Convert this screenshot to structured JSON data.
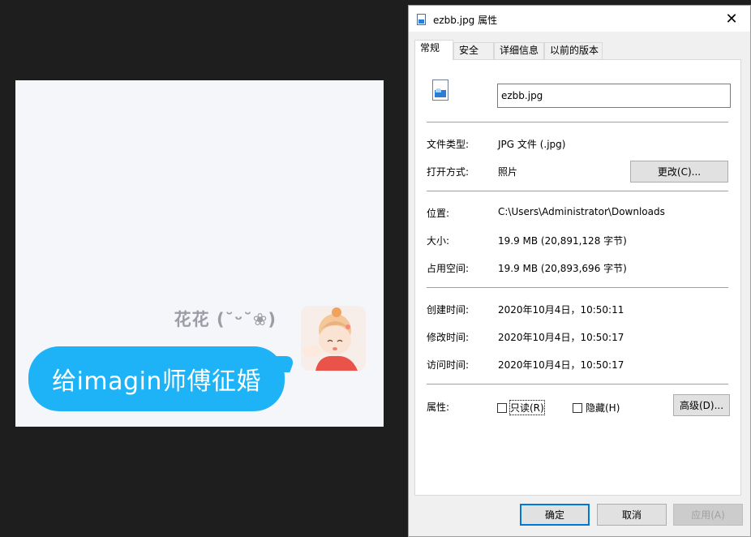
{
  "chat": {
    "sender_name": "花花 (˘ᵕ˘❀)",
    "message": "给imagin师傅征婚"
  },
  "dialog": {
    "title": "ezbb.jpg 属性",
    "close_glyph": "✕",
    "tabs": [
      "常规",
      "安全",
      "详细信息",
      "以前的版本"
    ],
    "active_tab": "常规",
    "file_name": "ezbb.jpg",
    "file_type_label": "文件类型:",
    "file_type_value": "JPG 文件 (.jpg)",
    "opens_with_label": "打开方式:",
    "opens_with_value": "照片",
    "change_button": "更改(C)...",
    "location_label": "位置:",
    "location_value": "C:\\Users\\Administrator\\Downloads",
    "size_label": "大小:",
    "size_value": "19.9 MB (20,891,128 字节)",
    "size_on_disk_label": "占用空间:",
    "size_on_disk_value": "19.9 MB (20,893,696 字节)",
    "created_label": "创建时间:",
    "created_value": "2020年10月4日，10:50:11",
    "modified_label": "修改时间:",
    "modified_value": "2020年10月4日，10:50:17",
    "accessed_label": "访问时间:",
    "accessed_value": "2020年10月4日，10:50:17",
    "attributes_label": "属性:",
    "readonly_label": "只读(R)",
    "readonly_checked": false,
    "hidden_label": "隐藏(H)",
    "hidden_checked": false,
    "advanced_button": "高级(D)...",
    "ok_button": "确定",
    "cancel_button": "取消",
    "apply_button": "应用(A)"
  },
  "icons": {
    "title_icon": "image-file-icon",
    "file_icon": "image-file-icon",
    "close": "close-icon"
  },
  "colors": {
    "bubble": "#1db3f6",
    "chat_bg": "#f5f6fa",
    "accent": "#0078d7"
  }
}
